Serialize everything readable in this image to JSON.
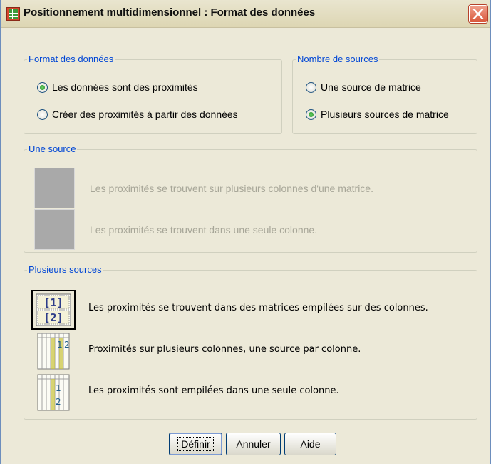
{
  "window": {
    "title": "Positionnement multidimensionnel : Format des données"
  },
  "data_format": {
    "legend": "Format des données",
    "options": [
      {
        "label": "Les données sont des proximités",
        "selected": true
      },
      {
        "label": "Créer des proximités à partir des données",
        "selected": false
      }
    ]
  },
  "source_count": {
    "legend": "Nombre de sources",
    "options": [
      {
        "label": "Une source de matrice",
        "selected": false
      },
      {
        "label": "Plusieurs sources de matrice",
        "selected": true
      }
    ]
  },
  "one_source": {
    "legend": "Une source",
    "enabled": false,
    "options": [
      {
        "label": "Les proximités se trouvent sur plusieurs colonnes d'une matrice."
      },
      {
        "label": "Les proximités se trouvent dans une seule colonne."
      }
    ]
  },
  "multiple_sources": {
    "legend": "Plusieurs sources",
    "options": [
      {
        "label": "Les proximités se trouvent dans des matrices empilées sur des colonnes.",
        "icon": "stacked-matrices-icon",
        "selected": true
      },
      {
        "label": "Proximités sur plusieurs colonnes, une source par colonne.",
        "icon": "multiple-columns-icon",
        "selected": false
      },
      {
        "label": "Les proximités sont empilées dans une seule colonne.",
        "icon": "single-column-icon",
        "selected": false
      }
    ]
  },
  "buttons": {
    "define": "Définir",
    "cancel": "Annuler",
    "help": "Aide"
  },
  "colors": {
    "legend_text": "#0046d5",
    "radio_on": "#2a9a2a",
    "disabled_text": "#a7a698"
  }
}
